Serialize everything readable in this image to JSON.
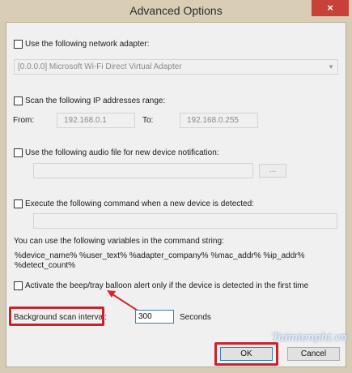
{
  "window": {
    "title": "Advanced Options",
    "close_glyph": "×"
  },
  "network_adapter": {
    "label": "Use the following network adapter:",
    "checked": false,
    "selected_value": "[0.0.0.0]  Microsoft Wi-Fi Direct Virtual Adapter"
  },
  "ip_range": {
    "label": "Scan the following IP addresses range:",
    "checked": false,
    "from_label": "From:",
    "from_value": "192.168.0.1",
    "to_label": "To:",
    "to_value": "192.168.0.255"
  },
  "audio_file": {
    "label": "Use the following audio file for new device notification:",
    "checked": false,
    "value": "",
    "browse_label": "..."
  },
  "command": {
    "label": "Execute the following command when a new device is detected:",
    "checked": false,
    "value": ""
  },
  "variables": {
    "intro": "You can use the following variables in the command string:",
    "list": "%device_name%  %user_text%  %adapter_company%  %mac_addr%  %ip_addr%  %detect_count%"
  },
  "beep": {
    "label": "Activate the beep/tray balloon alert only if the device is detected in the first time",
    "checked": false
  },
  "scan_interval": {
    "label": "Background scan interval:",
    "value": "300",
    "unit": "Seconds"
  },
  "buttons": {
    "ok": "OK",
    "cancel": "Cancel"
  },
  "watermark": "Taimienphi.vn",
  "colors": {
    "highlight": "#c9232b",
    "close_button": "#c7413a"
  }
}
